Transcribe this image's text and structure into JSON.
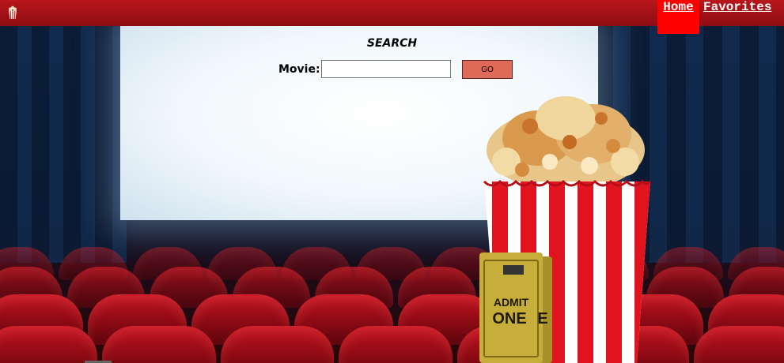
{
  "nav": {
    "home_label": "Home",
    "favorites_label": "Favorites",
    "active": "Home"
  },
  "search": {
    "title": "SEARCH",
    "movie_label": "Movie:",
    "input_value": "",
    "go_label": "GO"
  },
  "ticket": {
    "line1": "ADMIT",
    "line2": "ONE"
  },
  "icons": {
    "logo": "popcorn-icon"
  },
  "colors": {
    "topbar": "#a31117",
    "active_tab": "#ff0000",
    "go_button": "#e06a58"
  }
}
